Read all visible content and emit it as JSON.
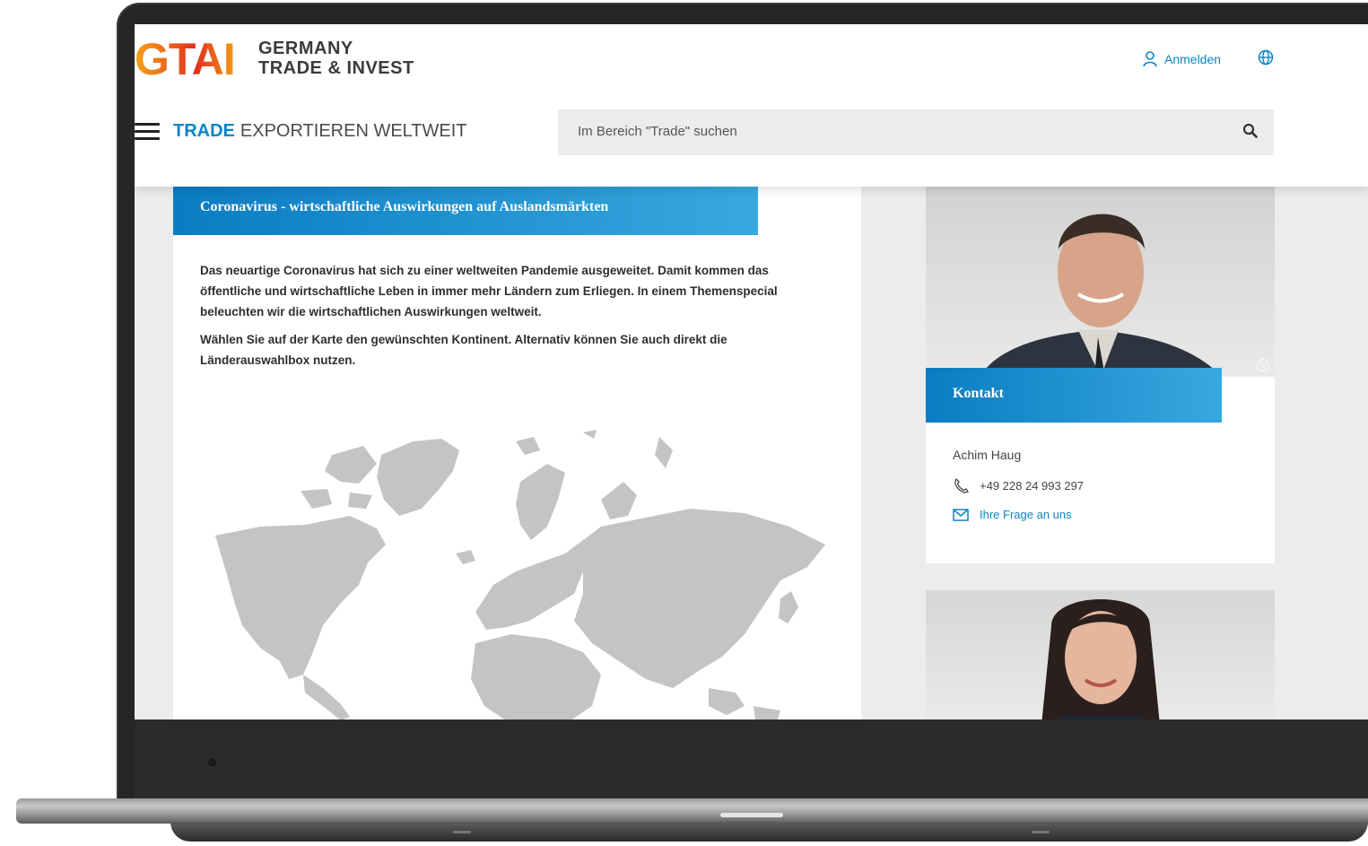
{
  "logo": {
    "mark": "GTAI",
    "line1": "GERMANY",
    "line2": "TRADE & INVEST"
  },
  "header": {
    "login_label": "Anmelden",
    "login_icon": "user-icon",
    "language_icon": "globe-icon",
    "menu_icon": "hamburger-icon",
    "section_highlight": "TRADE",
    "section_subtitle": "EXPORTIEREN WELTWEIT",
    "search_placeholder": "Im Bereich \"Trade\" suchen",
    "search_icon": "search-icon"
  },
  "main": {
    "banner_title": "Coronavirus - wirtschaftliche Auswirkungen auf Auslandsmärkten",
    "paragraph1": "Das neuartige Coronavirus hat sich zu einer weltweiten Pandemie ausgeweitet. Damit kommen das öffentliche und wirtschaftliche Leben in immer mehr Ländern zum Erliegen. In einem Themenspecial beleuchten wir die wirtschaftlichen Auswirkungen weltweit.",
    "paragraph2": "Wählen Sie auf der Karte den gewünschten Kontinent. Alternativ können Sie auch direkt die Länderauswahlbox nutzen."
  },
  "sidebar": {
    "contact_title": "Kontakt",
    "contact_name": "Achim Haug",
    "contact_phone": "+49 228 24 993 297",
    "contact_mail_label": "Ihre Frage an uns",
    "copyright_symbol": "©"
  },
  "colors": {
    "accent": "#0a84c6",
    "banner_start": "#0a7cc1",
    "banner_end": "#38a8e0",
    "map_land": "#c4c4c4"
  }
}
